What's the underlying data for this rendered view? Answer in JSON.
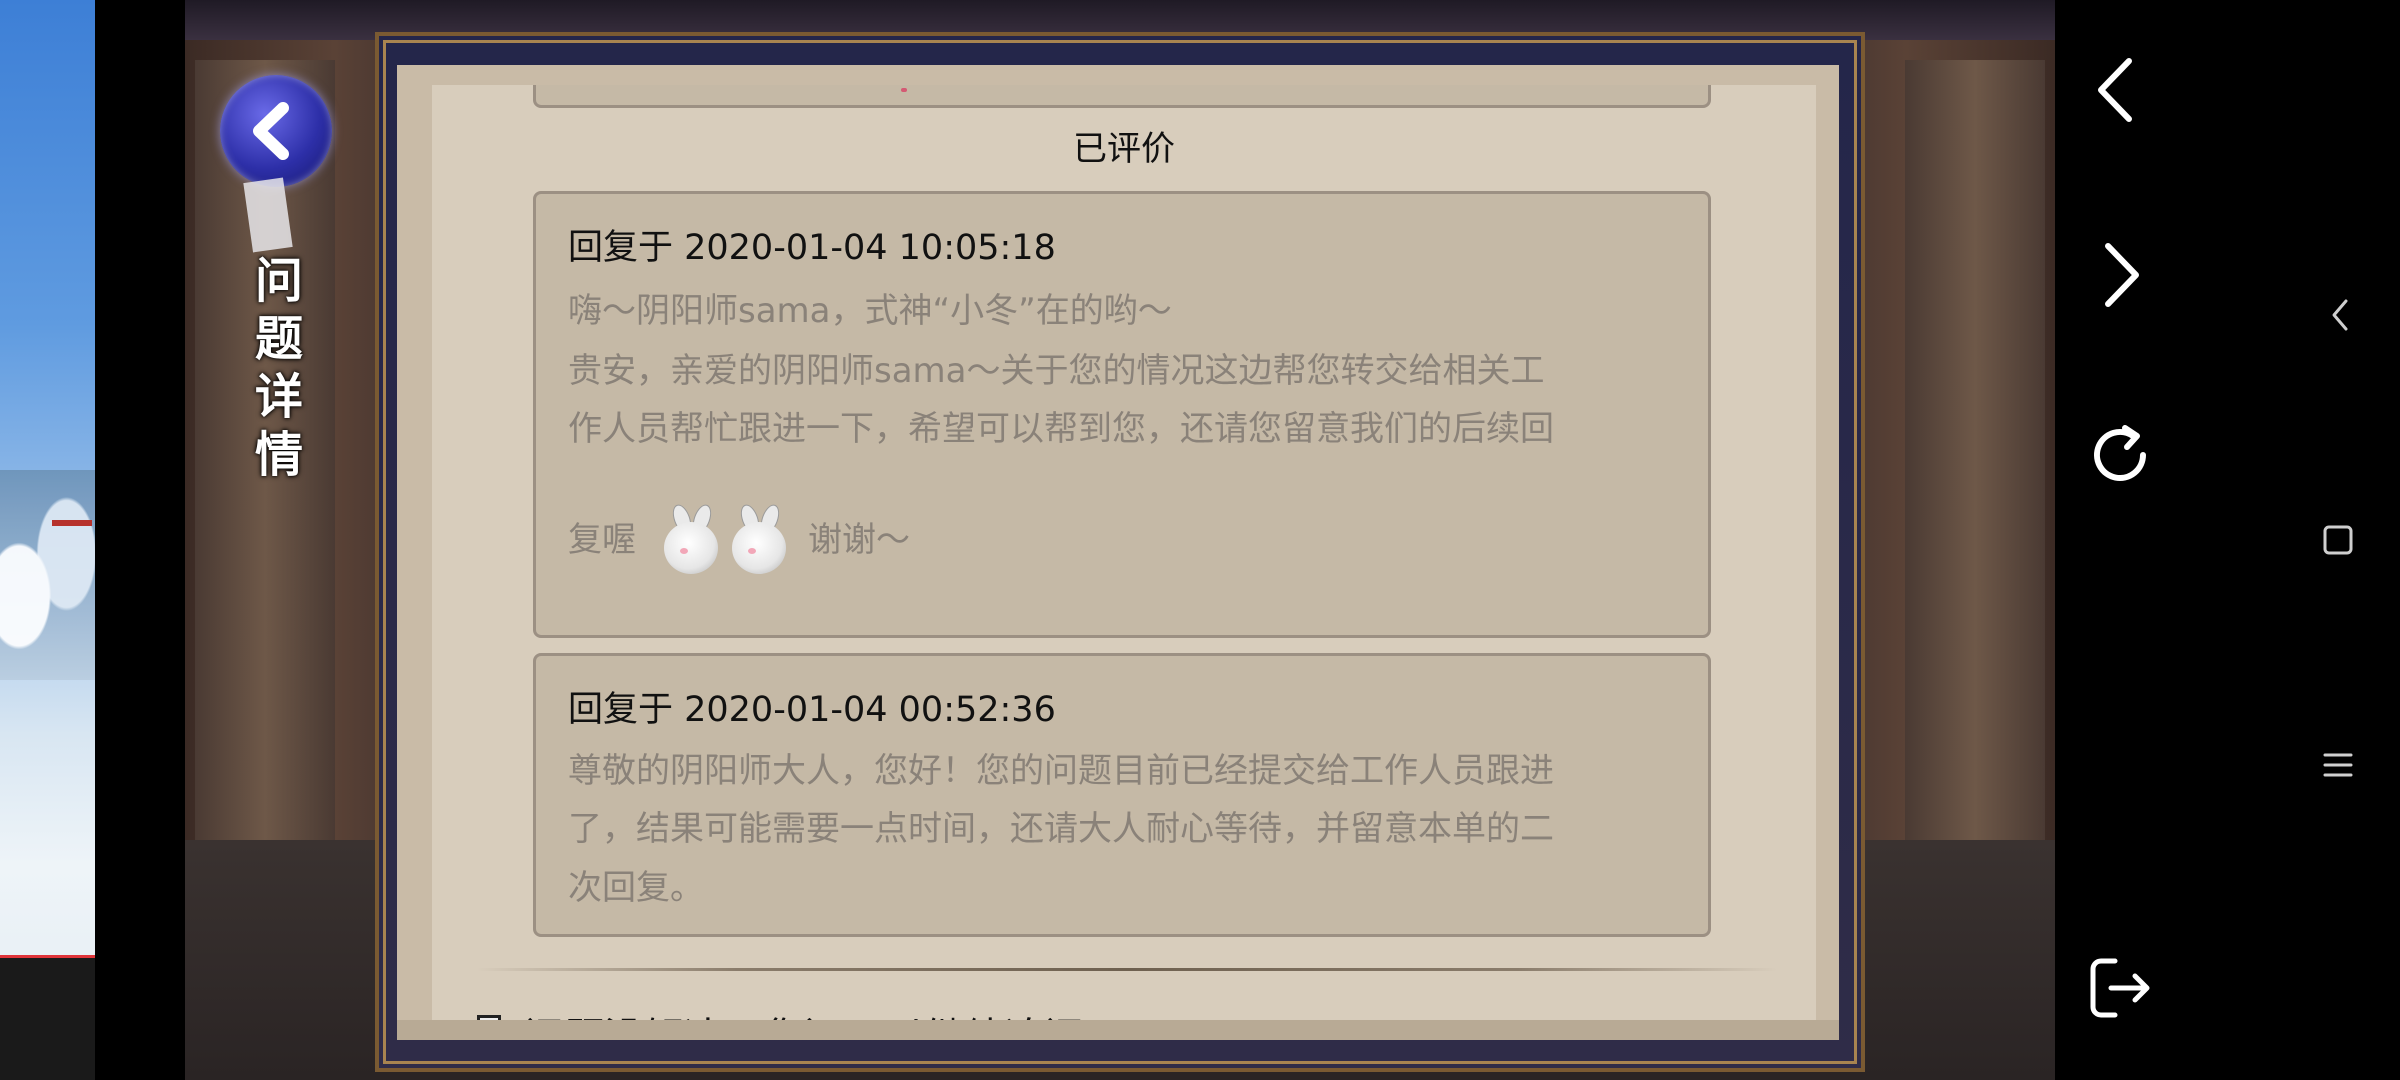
{
  "page": {
    "title": "问题详情",
    "rated_label": "已评价"
  },
  "replies": [
    {
      "time": "回复于 2020-01-04 10:05:18",
      "lines": [
        "嗨～阴阳师sama，式神“小冬”在的哟～",
        "贵安，亲爱的阴阳师sama～关于您的情况这边帮您转交给相关工",
        "作人员帮忙跟进一下，希望可以帮到您，还请您留意我们的后续回"
      ],
      "line4_before": "复喔",
      "line4_after": "谢谢～"
    },
    {
      "time": "回复于 2020-01-04 00:52:36",
      "lines": [
        "尊敬的阴阳师大人，您好！您的问题目前已经提交给工作人员跟进",
        "了，结果可能需要一点时间，还请大人耐心等待，并留意本单的二",
        "次回复。"
      ]
    }
  ],
  "footer": {
    "partial_text": "问题没解决？您还可以继续追问"
  },
  "browser_controls": {
    "icons": [
      "chevron-left-icon",
      "chevron-right-icon",
      "refresh-icon",
      "exit-icon"
    ]
  },
  "system_nav": {
    "icons": [
      "back-triangle-icon",
      "home-square-icon",
      "menu-lines-icon"
    ]
  },
  "colors": {
    "paper": "#d8cdbc",
    "card": "#c5b9a6",
    "card_border": "#9c9083",
    "body_text": "#8a8279",
    "title_text": "#ffffff",
    "back_button": "#2d2fa8"
  }
}
